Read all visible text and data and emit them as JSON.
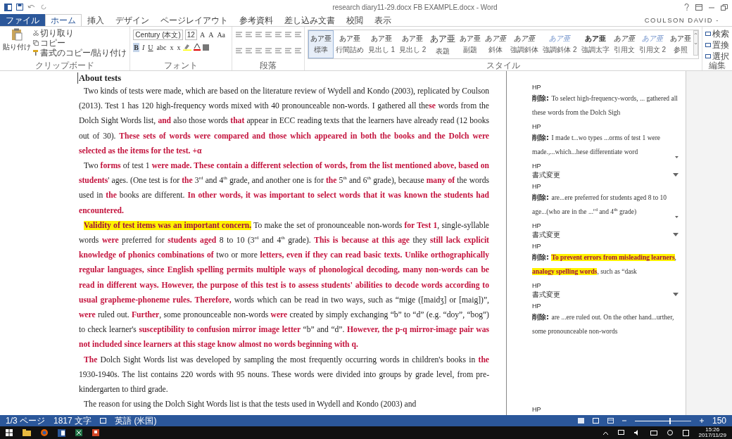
{
  "window": {
    "title": "research diary11-29.docx FB EXAMPLE.docx - Word",
    "user": "COULSON DAVID -"
  },
  "tabs": [
    {
      "label": "ファイル",
      "kind": "file",
      "selected": false
    },
    {
      "label": "ホーム",
      "kind": "tab",
      "selected": true
    },
    {
      "label": "挿入",
      "kind": "tab",
      "selected": false
    },
    {
      "label": "デザイン",
      "kind": "tab",
      "selected": false
    },
    {
      "label": "ページレイアウト",
      "kind": "tab",
      "selected": false
    },
    {
      "label": "参考資料",
      "kind": "tab",
      "selected": false
    },
    {
      "label": "差し込み文書",
      "kind": "tab",
      "selected": false
    },
    {
      "label": "校閲",
      "kind": "tab",
      "selected": false
    },
    {
      "label": "表示",
      "kind": "tab",
      "selected": false
    }
  ],
  "ribbon": {
    "clipboard": {
      "paste": "貼り付け",
      "cut": "切り取り",
      "copy": "コピー",
      "format_painter": "書式のコピー/貼り付け",
      "group": "クリップボード"
    },
    "font": {
      "name": "Century (本文)",
      "size": "12",
      "row1": [
        "A",
        "A",
        "Aa"
      ],
      "row2": [
        "B",
        "I",
        "U",
        "abc",
        "x",
        "x"
      ],
      "group": "フォント"
    },
    "paragraph": {
      "group": "段落"
    },
    "styles": {
      "group": "スタイル",
      "items": [
        {
          "preview": "あア亜",
          "name": "標準",
          "kind": "normal",
          "selected": true
        },
        {
          "preview": "あア亜",
          "name": "行間詰め",
          "kind": "normal",
          "selected": false
        },
        {
          "preview": "あア亜",
          "name": "見出し 1",
          "kind": "normal",
          "selected": false
        },
        {
          "preview": "あア亜",
          "name": "見出し 2",
          "kind": "normal",
          "selected": false
        },
        {
          "preview": "あア亜",
          "name": "表題",
          "kind": "large",
          "selected": false
        },
        {
          "preview": "あア亜",
          "name": "副題",
          "kind": "normal",
          "selected": false
        },
        {
          "preview": "あア亜",
          "name": "斜体",
          "kind": "italic",
          "selected": false
        },
        {
          "preview": "あア亜",
          "name": "強調斜体",
          "kind": "italic",
          "selected": false
        },
        {
          "preview": "あア亜",
          "name": "強調斜体 2",
          "kind": "light",
          "selected": false
        },
        {
          "preview": "あア亜",
          "name": "強調太字",
          "kind": "bold",
          "selected": false
        },
        {
          "preview": "あア亜",
          "name": "引用文",
          "kind": "italic",
          "selected": false
        },
        {
          "preview": "あア亜",
          "name": "引用文 2",
          "kind": "light",
          "selected": false
        },
        {
          "preview": "あア亜",
          "name": "参照",
          "kind": "normal",
          "selected": false
        }
      ]
    },
    "editing": {
      "group": "編集",
      "items": [
        "検索",
        "置換",
        "選択"
      ]
    }
  },
  "document": {
    "heading": "About tests",
    "paragraphs": [
      [
        {
          "kind": "plain",
          "text": "Two kinds of tests were made, which are based on the literature review of Wydell and Kondo (2003), replicated by Coulson (2013). Test 1 has 120 high-frequency words mixed with 40 pronounceable non-words. I gathered all the"
        },
        {
          "kind": "ins",
          "text": "se"
        },
        {
          "kind": "plain",
          "text": " words from the Dolch Sight Words list, "
        },
        {
          "kind": "ins",
          "text": "and"
        },
        {
          "kind": "plain",
          "text": " also those words "
        },
        {
          "kind": "ins",
          "text": "that"
        },
        {
          "kind": "plain",
          "text": " appear in ECC reading texts that the learners have already read (12 books out of 30). "
        },
        {
          "kind": "ins",
          "text": "These sets of words were compared and those which appeared in both the books and the Dolch were selected as the items for the test. +α"
        }
      ],
      [
        {
          "kind": "plain",
          "text": "Two "
        },
        {
          "kind": "ins",
          "text": "forms"
        },
        {
          "kind": "plain",
          "text": " of test 1 "
        },
        {
          "kind": "ins",
          "text": "were made. These contain a different selection of words, from the list mentioned above, based on students"
        },
        {
          "kind": "plain",
          "text": "' ages. (One test is for "
        },
        {
          "kind": "ins",
          "text": "the"
        },
        {
          "kind": "plain",
          "text": " 3$^{rd}$ and 4$^{th}$ grade, and another one is for "
        },
        {
          "kind": "ins",
          "text": "the"
        },
        {
          "kind": "plain",
          "text": " 5$^{th}$ and 6$^{th}$ grade), because "
        },
        {
          "kind": "ins",
          "text": "many of"
        },
        {
          "kind": "plain",
          "text": " the words used in "
        },
        {
          "kind": "ins",
          "text": "the"
        },
        {
          "kind": "plain",
          "text": " books are different. "
        },
        {
          "kind": "ins",
          "text": "In other words, it was important to select words that it was known the students had encountered."
        }
      ],
      [
        {
          "kind": "highlight",
          "text": "Validity of test items was an important concern."
        },
        {
          "kind": "plain",
          "text": " To make the set of pronounceable non-words "
        },
        {
          "kind": "ins",
          "text": "for Test 1"
        },
        {
          "kind": "plain",
          "text": ", single-syllable words "
        },
        {
          "kind": "ins",
          "text": "were"
        },
        {
          "kind": "plain",
          "text": " preferred for "
        },
        {
          "kind": "ins",
          "text": "students aged"
        },
        {
          "kind": "plain",
          "text": " 8 to 10 (3$^{rd}$ and 4$^{th}$ grade). "
        },
        {
          "kind": "ins",
          "text": "This is because at this age"
        },
        {
          "kind": "plain",
          "text": " they "
        },
        {
          "kind": "ins",
          "text": "still lack explicit knowledge of phonics combinations of"
        },
        {
          "kind": "plain",
          "text": " two or more "
        },
        {
          "kind": "ins",
          "text": "letters, even if they can read basic texts. Unlike orthographically regular languages, since English spelling permits multiple ways of phonological decoding, many non-words can be read in different ways. However, the purpose of this test is to assess students' abilities to decode words according to usual grapheme-phoneme rules. Therefore,"
        },
        {
          "kind": "plain",
          "text": " words which can be read in two ways, such as “mige ([maidʒ] or [maig])”, "
        },
        {
          "kind": "ins",
          "text": "were"
        },
        {
          "kind": "plain",
          "text": " ruled out. "
        },
        {
          "kind": "ins",
          "text": "Further"
        },
        {
          "kind": "plain",
          "text": ", some pronounceable non-words "
        },
        {
          "kind": "ins",
          "text": "were"
        },
        {
          "kind": "plain",
          "text": " created by simply exchanging “b” to “d” (e.g. “doy”, “bog”) to check learner's "
        },
        {
          "kind": "ins",
          "text": "susceptibility to confusion mirror image letter"
        },
        {
          "kind": "plain",
          "text": " “b” and “d”. "
        },
        {
          "kind": "ins",
          "text": "However, the p-q mirror-image pair was not included since learners at this stage know almost no words beginning with q."
        }
      ],
      [
        {
          "kind": "ins",
          "text": "The"
        },
        {
          "kind": "plain",
          "text": " Dolch Sight Words list was developed by sampling the most frequently occurring words in children's books in "
        },
        {
          "kind": "ins",
          "text": "the"
        },
        {
          "kind": "plain",
          "text": " 1930-1940s. The list contains 220 words with 95 nouns. These words were divided into groups by grade level, from pre-kindergarten to third grade."
        }
      ],
      [
        {
          "kind": "plain",
          "text": "The reason for using the Dolch Sight Words list is that the tests used in Wydell and Kondo (2003) and"
        }
      ]
    ]
  },
  "comments": [
    {
      "kind": "deletion",
      "author": "HP",
      "label": "削除:",
      "menu": false,
      "runs": [
        {
          "kind": "plain",
          "text": "To select high-frequency-words, ... gathered all these words from the Dolch Sigh"
        }
      ]
    },
    {
      "kind": "deletion",
      "author": "HP",
      "label": "削除:",
      "menu": true,
      "runs": [
        {
          "kind": "plain",
          "text": "I made t...wo types ...orms of test 1 were made.,...which...hese differentiate word"
        }
      ]
    },
    {
      "kind": "format",
      "author": "HP",
      "label": "書式変更",
      "menu": true
    },
    {
      "kind": "deletion",
      "author": "HP",
      "label": "削除:",
      "menu": true,
      "runs": [
        {
          "kind": "plain",
          "text": "are...ere preferred for students aged 8 to 10 age...(who are in the ...$^{rd}$ and 4$^{th}$ grade)"
        }
      ]
    },
    {
      "kind": "format",
      "author": "HP",
      "label": "書式変更",
      "menu": true
    },
    {
      "kind": "deletion",
      "author": "HP",
      "label": "削除:",
      "menu": false,
      "runs": [
        {
          "kind": "highlight",
          "text": "To prevent errors from misleading learners"
        },
        {
          "kind": "plain",
          "text": ", "
        },
        {
          "kind": "highlight",
          "text": "analogy spelling words"
        },
        {
          "kind": "plain",
          "text": ", such as “dask"
        }
      ]
    },
    {
      "kind": "format",
      "author": "HP",
      "label": "書式変更",
      "menu": true
    },
    {
      "kind": "deletion",
      "author": "HP",
      "label": "削除:",
      "menu": false,
      "runs": [
        {
          "kind": "plain",
          "text": "are ...ere ruled out. On the other hand...urther, some pronounceable non-words"
        }
      ]
    },
    {
      "kind": "author",
      "author": "HP"
    }
  ],
  "status_bar": {
    "page": "1/3 ページ",
    "words": "1817 文字",
    "language": "英語 (米国)",
    "zoom": {
      "level": 0.62,
      "reading": "150"
    }
  },
  "taskbar": {
    "time": "15:26",
    "date": "2017/11/29"
  }
}
